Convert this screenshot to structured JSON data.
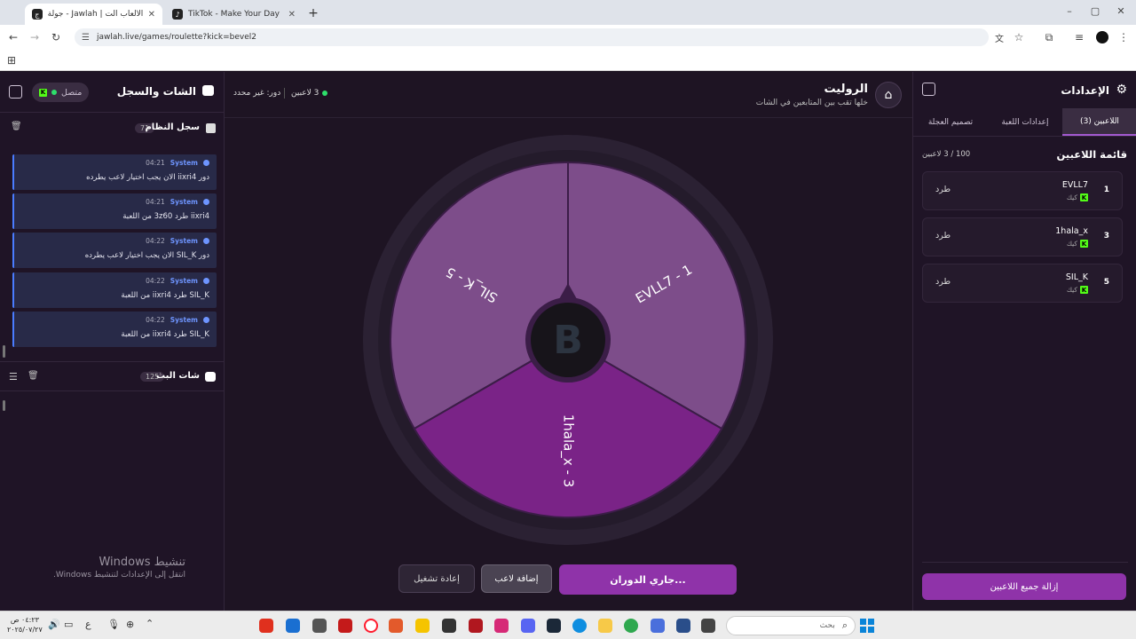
{
  "browser": {
    "tabs": [
      {
        "title": "جولة - Jawlah | منصة الألعاب الت"
      },
      {
        "title": "TikTok - Make Your Day"
      }
    ],
    "url": "jawlah.live/games/roulette?kick=bevel2"
  },
  "left_panel": {
    "title": "الشات والسجل",
    "status_label": "متصل",
    "system_log": {
      "title": "سجل النظام",
      "count": "71"
    },
    "messages": [
      {
        "sender": "System",
        "time": "04:21",
        "text": "دور iixri4 الان يجب اختيار لاعب يطرده"
      },
      {
        "sender": "System",
        "time": "04:21",
        "text": "iixri4 طرد 3z60 من اللعبة"
      },
      {
        "sender": "System",
        "time": "04:22",
        "text": "دور SIL_K الان يجب اختيار لاعب يطرده"
      },
      {
        "sender": "System",
        "time": "04:22",
        "text": "SIL_K طرد iixri4 من اللعبة"
      },
      {
        "sender": "System",
        "time": "04:22",
        "text": "SIL_K طرد iixri4 من اللعبة"
      }
    ],
    "stream_chat": {
      "title": "شات البث",
      "count": "125"
    }
  },
  "windows_activation": {
    "title": "تنشيط Windows",
    "subtitle": "انتقل إلى الإعدادات لتنشيط Windows."
  },
  "center": {
    "title": "الروليت",
    "subtitle": "خلها تقب بين المتابعين في الشات",
    "players_status": "3 لاعبين",
    "turn_status": "دور: غير محدد",
    "wheel_segments": [
      {
        "label": "SIL_K - 5",
        "color": "#7d4d8a"
      },
      {
        "label": "EVLL7 - 1",
        "color": "#7d4d8a"
      },
      {
        "label": "1hala_x - 3",
        "color": "#7a2387"
      }
    ],
    "buttons": {
      "spinning": "جاري الدوران...",
      "add_player": "إضافة لاعب",
      "replay": "إعادة تشغيل"
    }
  },
  "right_panel": {
    "title": "الإعدادات",
    "tabs": [
      "اللاعبين (3)",
      "إعدادات اللعبة",
      "تصميم العجلة"
    ],
    "list_title": "قائمة اللاعبين",
    "list_count": "100 / 3 لاعبين",
    "players": [
      {
        "num": "1",
        "name": "EVLL7",
        "platform": "كيك"
      },
      {
        "num": "3",
        "name": "1hala_x",
        "platform": "كيك"
      },
      {
        "num": "5",
        "name": "SIL_K",
        "platform": "كيك"
      }
    ],
    "kick_label": "طرد",
    "remove_all": "إزالة جميع اللاعبين"
  },
  "taskbar": {
    "search_placeholder": "بحث",
    "time": "٠٤:٢٣ ص",
    "date": "٢٠٢٥/٠٧/٢٧"
  },
  "colors": {
    "accent": "#8f33a9",
    "kick_green": "#53fc18",
    "system_blue": "#4a7cff"
  }
}
